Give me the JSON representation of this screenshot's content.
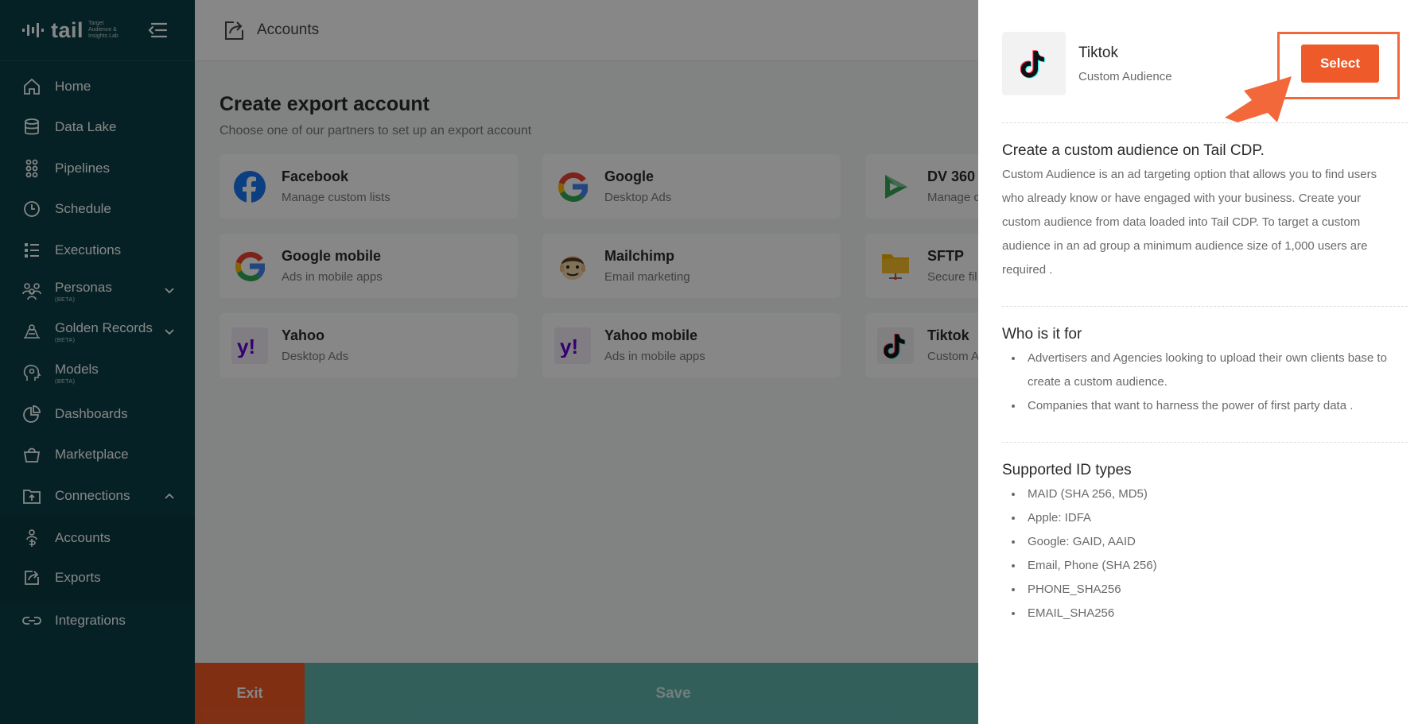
{
  "sidebar": {
    "brand": {
      "word": "tail",
      "tagline": "Target Audience & Insights Lab"
    },
    "items": [
      {
        "label": "Home"
      },
      {
        "label": "Data Lake"
      },
      {
        "label": "Pipelines"
      },
      {
        "label": "Schedule"
      },
      {
        "label": "Executions"
      },
      {
        "label": "Personas",
        "badge": "(BETA)"
      },
      {
        "label": "Golden Records",
        "badge": "(BETA)"
      },
      {
        "label": "Models",
        "badge": "(BETA)"
      },
      {
        "label": "Dashboards"
      },
      {
        "label": "Marketplace"
      },
      {
        "label": "Connections"
      }
    ],
    "subitems": [
      {
        "label": "Accounts"
      },
      {
        "label": "Exports"
      }
    ],
    "bottom_item": {
      "label": "Integrations"
    }
  },
  "topbar": {
    "title": "Accounts"
  },
  "main": {
    "title": "Create export account",
    "subtitle": "Choose one of our partners to set up an export account",
    "cards": [
      {
        "name": "Facebook",
        "desc": "Manage custom lists"
      },
      {
        "name": "Google",
        "desc": "Desktop Ads"
      },
      {
        "name": "DV 360",
        "desc": "Manage c"
      },
      {
        "name": "Google mobile",
        "desc": "Ads in mobile apps"
      },
      {
        "name": "Mailchimp",
        "desc": "Email marketing"
      },
      {
        "name": "SFTP",
        "desc": "Secure fil"
      },
      {
        "name": "Yahoo",
        "desc": "Desktop Ads"
      },
      {
        "name": "Yahoo mobile",
        "desc": "Ads in mobile apps"
      },
      {
        "name": "Tiktok",
        "desc": "Custom A"
      }
    ],
    "exit_label": "Exit",
    "save_label": "Save"
  },
  "panel": {
    "title": "Tiktok",
    "subtitle": "Custom Audience",
    "select_label": "Select",
    "section1": {
      "title": "Create a custom audience on Tail CDP.",
      "text": "Custom Audience is an ad targeting option that allows you to find users who already know or have engaged with your business. Create your custom audience from data loaded into Tail CDP. To target a custom audience in an ad group a minimum audience size of 1,000 users are required ."
    },
    "section2": {
      "title": "Who is it for",
      "items": [
        "Advertisers and Agencies looking to upload their own clients base to create a custom audience.",
        "Companies that want to harness the power of first party data ."
      ]
    },
    "section3": {
      "title": "Supported ID types",
      "items": [
        "MAID (SHA 256, MD5)",
        "Apple: IDFA",
        "Google: GAID, AAID",
        "Email, Phone (SHA 256)",
        "PHONE_SHA256",
        "EMAIL_SHA256"
      ]
    }
  },
  "colors": {
    "sidebar_bg": "#0b3f47",
    "accent_orange": "#ee5a2a",
    "save_teal": "#5fb3ab"
  }
}
